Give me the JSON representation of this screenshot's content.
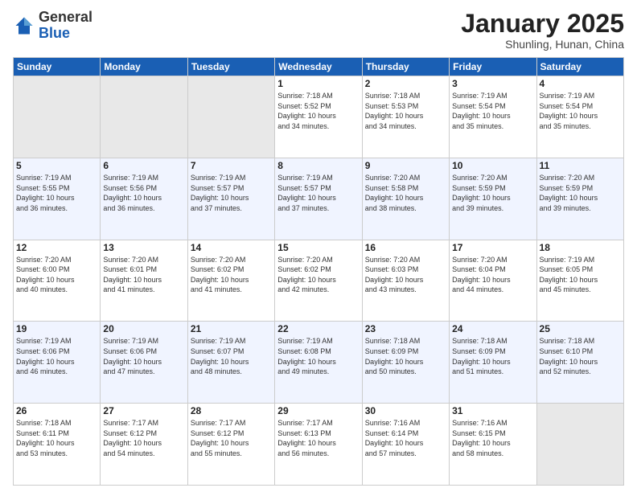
{
  "header": {
    "logo_general": "General",
    "logo_blue": "Blue",
    "month_title": "January 2025",
    "location": "Shunling, Hunan, China"
  },
  "weekdays": [
    "Sunday",
    "Monday",
    "Tuesday",
    "Wednesday",
    "Thursday",
    "Friday",
    "Saturday"
  ],
  "weeks": [
    [
      {
        "day": "",
        "info": ""
      },
      {
        "day": "",
        "info": ""
      },
      {
        "day": "",
        "info": ""
      },
      {
        "day": "1",
        "info": "Sunrise: 7:18 AM\nSunset: 5:52 PM\nDaylight: 10 hours\nand 34 minutes."
      },
      {
        "day": "2",
        "info": "Sunrise: 7:18 AM\nSunset: 5:53 PM\nDaylight: 10 hours\nand 34 minutes."
      },
      {
        "day": "3",
        "info": "Sunrise: 7:19 AM\nSunset: 5:54 PM\nDaylight: 10 hours\nand 35 minutes."
      },
      {
        "day": "4",
        "info": "Sunrise: 7:19 AM\nSunset: 5:54 PM\nDaylight: 10 hours\nand 35 minutes."
      }
    ],
    [
      {
        "day": "5",
        "info": "Sunrise: 7:19 AM\nSunset: 5:55 PM\nDaylight: 10 hours\nand 36 minutes."
      },
      {
        "day": "6",
        "info": "Sunrise: 7:19 AM\nSunset: 5:56 PM\nDaylight: 10 hours\nand 36 minutes."
      },
      {
        "day": "7",
        "info": "Sunrise: 7:19 AM\nSunset: 5:57 PM\nDaylight: 10 hours\nand 37 minutes."
      },
      {
        "day": "8",
        "info": "Sunrise: 7:19 AM\nSunset: 5:57 PM\nDaylight: 10 hours\nand 37 minutes."
      },
      {
        "day": "9",
        "info": "Sunrise: 7:20 AM\nSunset: 5:58 PM\nDaylight: 10 hours\nand 38 minutes."
      },
      {
        "day": "10",
        "info": "Sunrise: 7:20 AM\nSunset: 5:59 PM\nDaylight: 10 hours\nand 39 minutes."
      },
      {
        "day": "11",
        "info": "Sunrise: 7:20 AM\nSunset: 5:59 PM\nDaylight: 10 hours\nand 39 minutes."
      }
    ],
    [
      {
        "day": "12",
        "info": "Sunrise: 7:20 AM\nSunset: 6:00 PM\nDaylight: 10 hours\nand 40 minutes."
      },
      {
        "day": "13",
        "info": "Sunrise: 7:20 AM\nSunset: 6:01 PM\nDaylight: 10 hours\nand 41 minutes."
      },
      {
        "day": "14",
        "info": "Sunrise: 7:20 AM\nSunset: 6:02 PM\nDaylight: 10 hours\nand 41 minutes."
      },
      {
        "day": "15",
        "info": "Sunrise: 7:20 AM\nSunset: 6:02 PM\nDaylight: 10 hours\nand 42 minutes."
      },
      {
        "day": "16",
        "info": "Sunrise: 7:20 AM\nSunset: 6:03 PM\nDaylight: 10 hours\nand 43 minutes."
      },
      {
        "day": "17",
        "info": "Sunrise: 7:20 AM\nSunset: 6:04 PM\nDaylight: 10 hours\nand 44 minutes."
      },
      {
        "day": "18",
        "info": "Sunrise: 7:19 AM\nSunset: 6:05 PM\nDaylight: 10 hours\nand 45 minutes."
      }
    ],
    [
      {
        "day": "19",
        "info": "Sunrise: 7:19 AM\nSunset: 6:06 PM\nDaylight: 10 hours\nand 46 minutes."
      },
      {
        "day": "20",
        "info": "Sunrise: 7:19 AM\nSunset: 6:06 PM\nDaylight: 10 hours\nand 47 minutes."
      },
      {
        "day": "21",
        "info": "Sunrise: 7:19 AM\nSunset: 6:07 PM\nDaylight: 10 hours\nand 48 minutes."
      },
      {
        "day": "22",
        "info": "Sunrise: 7:19 AM\nSunset: 6:08 PM\nDaylight: 10 hours\nand 49 minutes."
      },
      {
        "day": "23",
        "info": "Sunrise: 7:18 AM\nSunset: 6:09 PM\nDaylight: 10 hours\nand 50 minutes."
      },
      {
        "day": "24",
        "info": "Sunrise: 7:18 AM\nSunset: 6:09 PM\nDaylight: 10 hours\nand 51 minutes."
      },
      {
        "day": "25",
        "info": "Sunrise: 7:18 AM\nSunset: 6:10 PM\nDaylight: 10 hours\nand 52 minutes."
      }
    ],
    [
      {
        "day": "26",
        "info": "Sunrise: 7:18 AM\nSunset: 6:11 PM\nDaylight: 10 hours\nand 53 minutes."
      },
      {
        "day": "27",
        "info": "Sunrise: 7:17 AM\nSunset: 6:12 PM\nDaylight: 10 hours\nand 54 minutes."
      },
      {
        "day": "28",
        "info": "Sunrise: 7:17 AM\nSunset: 6:12 PM\nDaylight: 10 hours\nand 55 minutes."
      },
      {
        "day": "29",
        "info": "Sunrise: 7:17 AM\nSunset: 6:13 PM\nDaylight: 10 hours\nand 56 minutes."
      },
      {
        "day": "30",
        "info": "Sunrise: 7:16 AM\nSunset: 6:14 PM\nDaylight: 10 hours\nand 57 minutes."
      },
      {
        "day": "31",
        "info": "Sunrise: 7:16 AM\nSunset: 6:15 PM\nDaylight: 10 hours\nand 58 minutes."
      },
      {
        "day": "",
        "info": ""
      }
    ]
  ]
}
